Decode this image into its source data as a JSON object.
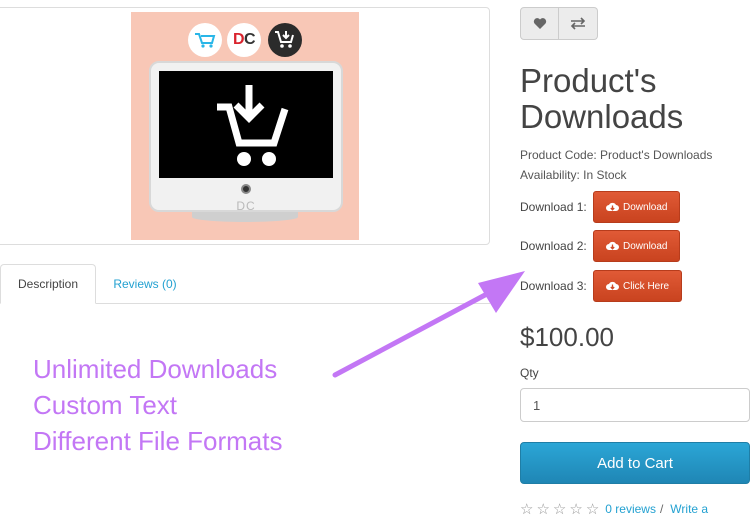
{
  "product_image": {
    "logos": [
      "opencart-logo",
      "dc-logo",
      "download-cart-logo"
    ],
    "dc_logo_d": "D",
    "dc_logo_c": "C",
    "monitor_brand": "DC",
    "background_color": "#f8c7b6"
  },
  "tabs": [
    {
      "label": "Description",
      "active": true
    },
    {
      "label": "Reviews (0)",
      "active": false
    }
  ],
  "annotation": {
    "lines": [
      "Unlimited Downloads",
      "Custom Text",
      "Different File Formats"
    ],
    "color": "#c377f5"
  },
  "product": {
    "title_line1": "Product's",
    "title_line2": "Downloads",
    "code_text": "Product Code: Product's Downloads",
    "availability_text": "Availability: In Stock",
    "downloads": [
      {
        "label": "Download 1:",
        "button": "Download"
      },
      {
        "label": "Download 2:",
        "button": "Download"
      },
      {
        "label": "Download 3:",
        "button": "Click Here"
      }
    ],
    "price": "$100.00",
    "qty_label": "Qty",
    "qty_value": "1",
    "add_to_cart": "Add to Cart",
    "rating": 0,
    "reviews_link": "0 reviews",
    "separator": "/",
    "write_link": "Write a"
  },
  "icons": {
    "wishlist": "heart-icon",
    "compare": "exchange-icon",
    "download": "cloud-download-icon"
  },
  "colors": {
    "download_button": "#da4f2c",
    "cart_button": "#229ac8",
    "link": "#23a1d1"
  }
}
